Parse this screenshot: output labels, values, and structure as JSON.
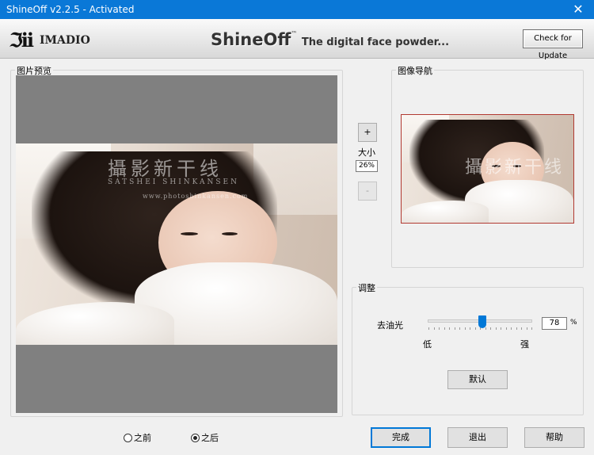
{
  "window": {
    "title": "ShineOff v2.2.5 - Activated",
    "close_glyph": "✕"
  },
  "header": {
    "logo_mark": "ℑii",
    "logo_text": "IMADIO",
    "brand_name": "ShineOff",
    "brand_tm": "™",
    "tagline": "The digital face powder...",
    "update_button": "Check for Update"
  },
  "preview": {
    "legend": "图片预览",
    "watermark_cn": "攝影新干线",
    "watermark_en": "SATSHEI SHINKANSEN",
    "watermark_url": "www.photoshinkansen.com"
  },
  "zoom": {
    "plus": "+",
    "label": "大小",
    "value": "26%",
    "minus": "-"
  },
  "navigator": {
    "legend": "图像导航"
  },
  "adjust": {
    "legend": "调整",
    "slider_label": "去油光",
    "min_label": "低",
    "max_label": "强",
    "value": "78",
    "unit": "%",
    "slider_fraction": 0.52,
    "default_button": "默认"
  },
  "view_mode": {
    "before": "之前",
    "after": "之后",
    "selected": "after"
  },
  "footer": {
    "finish": "完成",
    "exit": "退出",
    "help": "帮助"
  },
  "colors": {
    "titlebar": "#0a78d7",
    "accent": "#0078d7",
    "nav_frame": "#b23a32",
    "preview_bg": "#808080"
  }
}
